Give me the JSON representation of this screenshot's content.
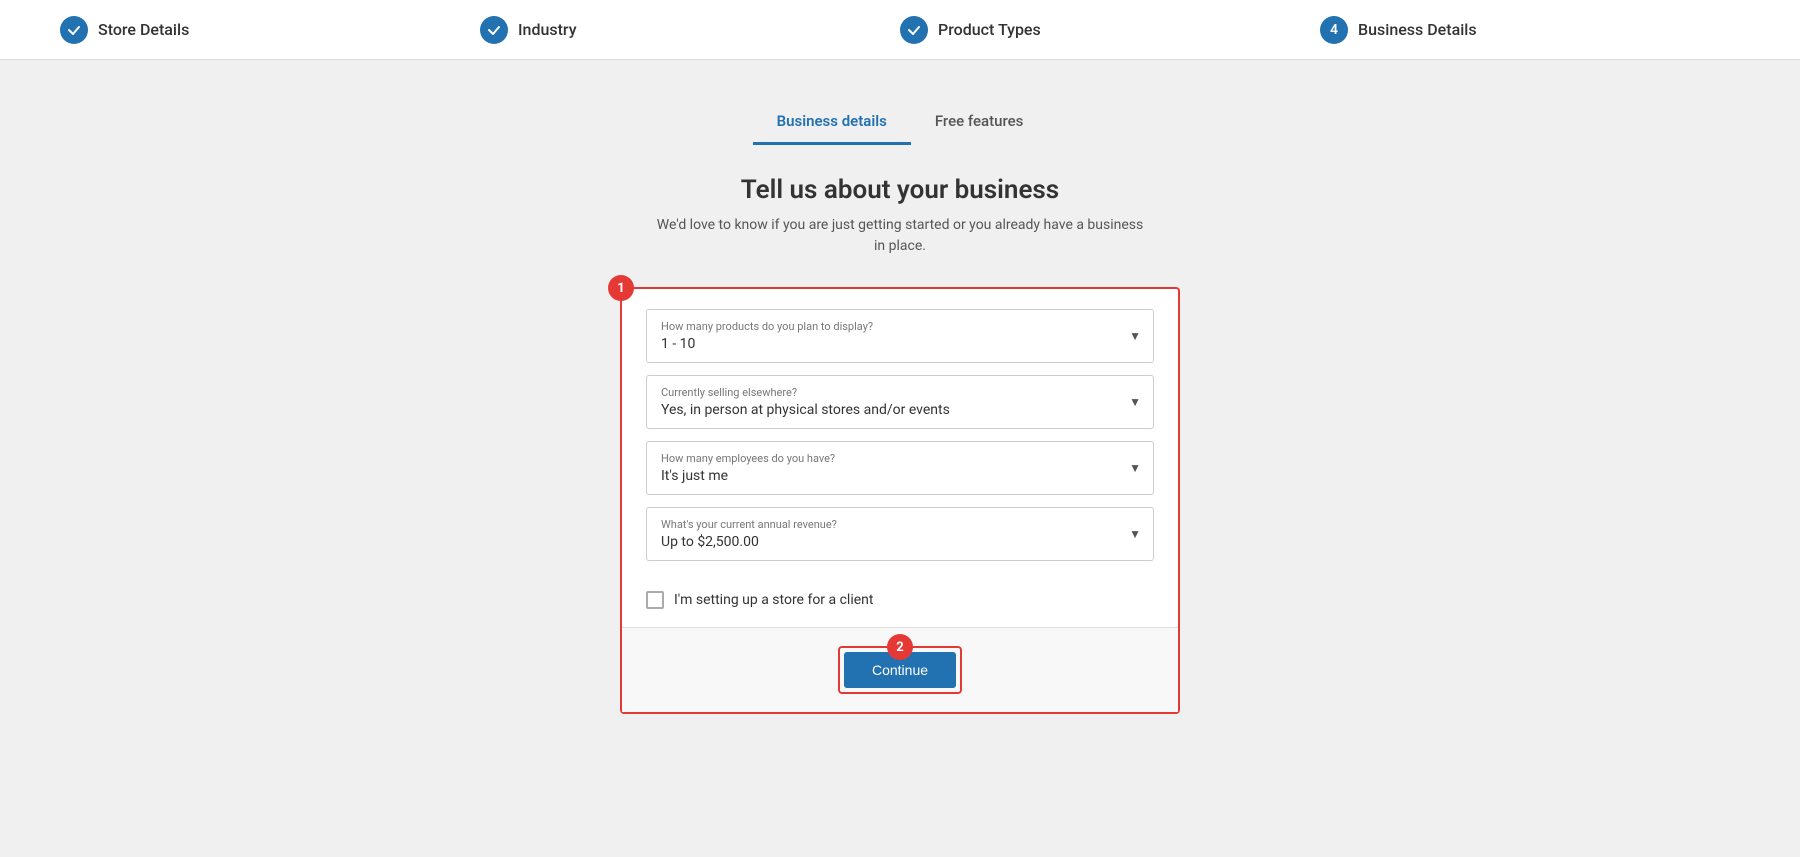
{
  "stepper": {
    "steps": [
      {
        "id": "store-details",
        "label": "Store Details",
        "state": "completed",
        "number": "✓"
      },
      {
        "id": "industry",
        "label": "Industry",
        "state": "completed",
        "number": "✓"
      },
      {
        "id": "product-types",
        "label": "Product Types",
        "state": "completed",
        "number": "✓"
      },
      {
        "id": "business-details",
        "label": "Business Details",
        "state": "active",
        "number": "4"
      }
    ]
  },
  "tabs": [
    {
      "id": "business-details",
      "label": "Business details",
      "active": true
    },
    {
      "id": "free-features",
      "label": "Free features",
      "active": false
    }
  ],
  "page": {
    "title": "Tell us about your business",
    "subtitle": "We'd love to know if you are just getting started or you already have a business in place."
  },
  "form": {
    "annotation1": "1",
    "annotation2": "2",
    "fields": [
      {
        "id": "products-count",
        "label": "How many products do you plan to display?",
        "value": "1 - 10"
      },
      {
        "id": "selling-elsewhere",
        "label": "Currently selling elsewhere?",
        "value": "Yes, in person at physical stores and/or events"
      },
      {
        "id": "employees",
        "label": "How many employees do you have?",
        "value": "It's just me"
      },
      {
        "id": "annual-revenue",
        "label": "What's your current annual revenue?",
        "value": "Up to $2,500.00"
      }
    ],
    "checkbox": {
      "label": "I'm setting up a store for a client",
      "checked": false
    },
    "continue_button": "Continue"
  }
}
